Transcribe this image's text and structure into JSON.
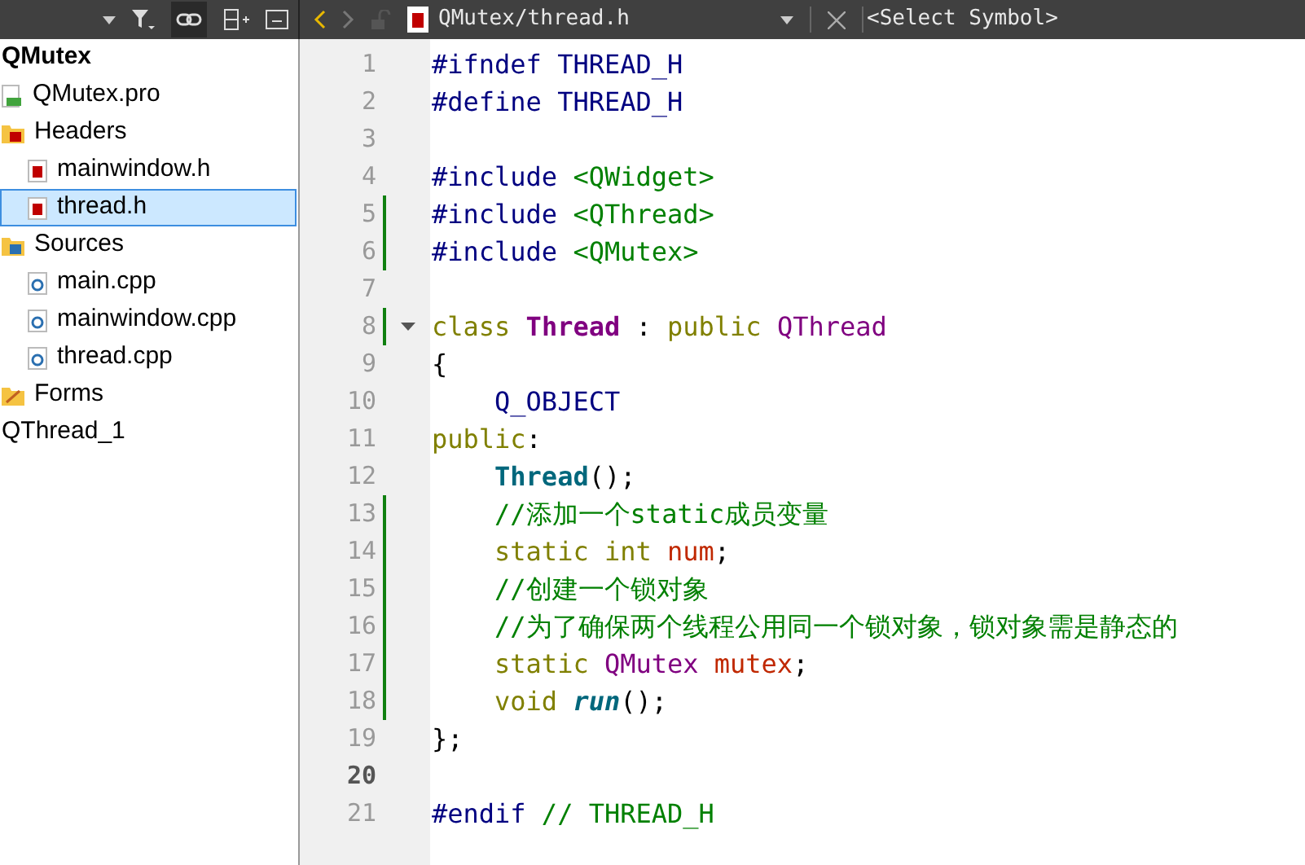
{
  "toolbar": {
    "file_path": "QMutex/thread.h",
    "symbol": "<Select Symbol>"
  },
  "tree": [
    {
      "label": "QMutex",
      "kind": "project",
      "selected": false,
      "children": [
        {
          "label": "QMutex.pro",
          "kind": "pro",
          "selected": false
        },
        {
          "label": "Headers",
          "kind": "header-folder",
          "selected": false,
          "children": [
            {
              "label": "mainwindow.h",
              "kind": "header",
              "selected": false
            },
            {
              "label": "thread.h",
              "kind": "header",
              "selected": true
            }
          ]
        },
        {
          "label": "Sources",
          "kind": "source-folder",
          "selected": false,
          "children": [
            {
              "label": "main.cpp",
              "kind": "source",
              "selected": false
            },
            {
              "label": "mainwindow.cpp",
              "kind": "source",
              "selected": false
            },
            {
              "label": "thread.cpp",
              "kind": "source",
              "selected": false
            }
          ]
        },
        {
          "label": "Forms",
          "kind": "form-folder",
          "selected": false
        }
      ]
    },
    {
      "label": "QThread_1",
      "kind": "project",
      "selected": false
    }
  ],
  "lines": [
    {
      "number": "1",
      "changed": false,
      "foldable": false,
      "current": false,
      "tokens": [
        {
          "text": "#ifndef",
          "kind": "pre"
        },
        {
          "text": " THREAD_H",
          "kind": "pre"
        }
      ]
    },
    {
      "number": "2",
      "changed": false,
      "foldable": false,
      "current": false,
      "tokens": [
        {
          "text": "#define",
          "kind": "pre"
        },
        {
          "text": " THREAD_H",
          "kind": "pre"
        }
      ]
    },
    {
      "number": "3",
      "changed": false,
      "foldable": false,
      "current": false
    },
    {
      "number": "4",
      "changed": false,
      "foldable": false,
      "current": false,
      "tokens": [
        {
          "text": "#include",
          "kind": "pre"
        },
        {
          "text": " <QWidget>",
          "kind": "inc"
        }
      ]
    },
    {
      "number": "5",
      "changed": true,
      "foldable": false,
      "current": false,
      "tokens": [
        {
          "text": "#include",
          "kind": "pre"
        },
        {
          "text": " <QThread>",
          "kind": "inc"
        }
      ]
    },
    {
      "number": "6",
      "changed": true,
      "foldable": false,
      "current": false,
      "tokens": [
        {
          "text": "#include",
          "kind": "pre"
        },
        {
          "text": " <QMutex>",
          "kind": "inc"
        }
      ]
    },
    {
      "number": "7",
      "changed": false,
      "foldable": false,
      "current": false
    },
    {
      "number": "8",
      "changed": true,
      "foldable": true,
      "current": false,
      "tokens": [
        {
          "text": "class",
          "kind": "kw"
        },
        {
          "text": " Thread",
          "kind": "cls"
        },
        {
          "text": " :",
          "kind": "plain"
        },
        {
          "text": " public",
          "kind": "kw"
        },
        {
          "text": " QThread",
          "kind": "type"
        }
      ]
    },
    {
      "number": "9",
      "changed": false,
      "foldable": false,
      "current": false,
      "tokens": [
        {
          "text": "{",
          "kind": "plain"
        }
      ]
    },
    {
      "number": "10",
      "changed": false,
      "foldable": false,
      "current": false,
      "tokens": [
        {
          "text": "    Q_OBJECT",
          "kind": "pre"
        }
      ]
    },
    {
      "number": "11",
      "changed": false,
      "foldable": false,
      "current": false,
      "tokens": [
        {
          "text": "public",
          "kind": "kw"
        },
        {
          "text": ":",
          "kind": "plain"
        }
      ]
    },
    {
      "number": "12",
      "changed": false,
      "foldable": false,
      "current": false,
      "tokens": [
        {
          "text": "    Thread",
          "kind": "fn"
        },
        {
          "text": "();",
          "kind": "plain"
        }
      ]
    },
    {
      "number": "13",
      "changed": true,
      "foldable": false,
      "current": false,
      "tokens": [
        {
          "text": "    //添加一个static成员变量",
          "kind": "cmt"
        }
      ]
    },
    {
      "number": "14",
      "changed": true,
      "foldable": false,
      "current": false,
      "tokens": [
        {
          "text": "    static",
          "kind": "kw"
        },
        {
          "text": " int",
          "kind": "kw"
        },
        {
          "text": " num",
          "kind": "var"
        },
        {
          "text": ";",
          "kind": "plain"
        }
      ]
    },
    {
      "number": "15",
      "changed": true,
      "foldable": false,
      "current": false,
      "tokens": [
        {
          "text": "    //创建一个锁对象",
          "kind": "cmt"
        }
      ]
    },
    {
      "number": "16",
      "changed": true,
      "foldable": false,
      "current": false,
      "tokens": [
        {
          "text": "    //为了确保两个线程公用同一个锁对象，锁对象需是静态的",
          "kind": "cmt"
        }
      ]
    },
    {
      "number": "17",
      "changed": true,
      "foldable": false,
      "current": false,
      "tokens": [
        {
          "text": "    static",
          "kind": "kw"
        },
        {
          "text": " QMutex",
          "kind": "type"
        },
        {
          "text": " mutex",
          "kind": "var"
        },
        {
          "text": ";",
          "kind": "plain"
        }
      ]
    },
    {
      "number": "18",
      "changed": true,
      "foldable": false,
      "current": false,
      "tokens": [
        {
          "text": "    void",
          "kind": "kw"
        },
        {
          "text": " run",
          "kind": "vfn"
        },
        {
          "text": "();",
          "kind": "plain"
        }
      ]
    },
    {
      "number": "19",
      "changed": false,
      "foldable": false,
      "current": false,
      "tokens": [
        {
          "text": "};",
          "kind": "plain"
        }
      ]
    },
    {
      "number": "20",
      "changed": false,
      "foldable": false,
      "current": true
    },
    {
      "number": "21",
      "changed": false,
      "foldable": false,
      "current": false,
      "tokens": [
        {
          "text": "#endif",
          "kind": "pre"
        },
        {
          "text": " // THREAD_H",
          "kind": "cmt"
        }
      ]
    }
  ]
}
